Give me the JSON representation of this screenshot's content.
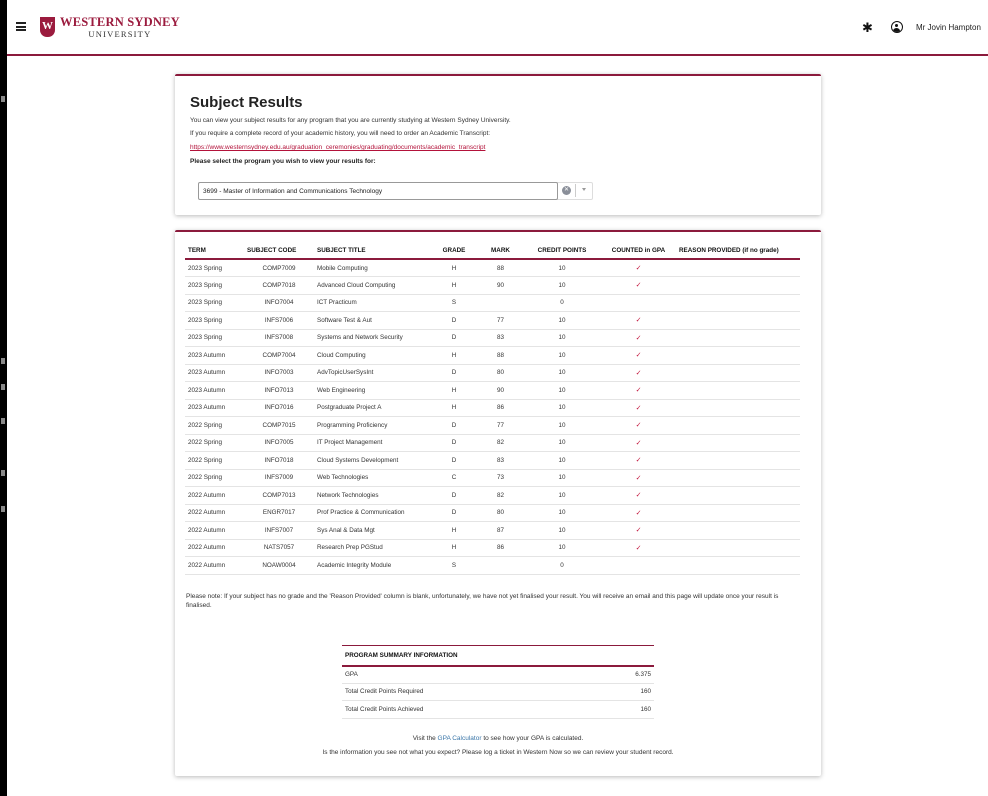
{
  "header": {
    "logo_mark": "W",
    "logo_line1": "WESTERN SYDNEY",
    "logo_line2": "UNIVERSITY",
    "user_name": "Mr Jovin Hampton"
  },
  "intro": {
    "title": "Subject Results",
    "para1": "You can view your subject results for any program that you are currently studying at Western Sydney University.",
    "para2": "If you require a complete record of your academic history, you will need to order an Academic Transcript:",
    "link": "https://www.westernsydney.edu.au/graduation_ceremonies/graduating/documents/academic_transcript",
    "select_prompt": "Please select the program you wish to view your results for:",
    "program_selected": "3699 - Master of Information and Communications Technology"
  },
  "results": {
    "columns": [
      "TERM",
      "SUBJECT CODE",
      "SUBJECT TITLE",
      "GRADE",
      "MARK",
      "CREDIT POINTS",
      "COUNTED in GPA",
      "REASON PROVIDED (if no grade)"
    ],
    "rows": [
      {
        "term": "2023 Spring",
        "code": "COMP7009",
        "title": "Mobile Computing",
        "grade": "H",
        "mark": "88",
        "credit": "10",
        "gpa": "✓",
        "reason": ""
      },
      {
        "term": "2023 Spring",
        "code": "COMP7018",
        "title": "Advanced Cloud Computing",
        "grade": "H",
        "mark": "90",
        "credit": "10",
        "gpa": "✓",
        "reason": ""
      },
      {
        "term": "2023 Spring",
        "code": "INFO7004",
        "title": "ICT Practicum",
        "grade": "S",
        "mark": "",
        "credit": "0",
        "gpa": "",
        "reason": ""
      },
      {
        "term": "2023 Spring",
        "code": "INFS7006",
        "title": "Software Test & Aut",
        "grade": "D",
        "mark": "77",
        "credit": "10",
        "gpa": "✓",
        "reason": ""
      },
      {
        "term": "2023 Spring",
        "code": "INFS7008",
        "title": "Systems and Network Security",
        "grade": "D",
        "mark": "83",
        "credit": "10",
        "gpa": "✓",
        "reason": ""
      },
      {
        "term": "2023 Autumn",
        "code": "COMP7004",
        "title": "Cloud Computing",
        "grade": "H",
        "mark": "88",
        "credit": "10",
        "gpa": "✓",
        "reason": ""
      },
      {
        "term": "2023 Autumn",
        "code": "INFO7003",
        "title": "AdvTopicUserSysInt",
        "grade": "D",
        "mark": "80",
        "credit": "10",
        "gpa": "✓",
        "reason": ""
      },
      {
        "term": "2023 Autumn",
        "code": "INFO7013",
        "title": "Web Engineering",
        "grade": "H",
        "mark": "90",
        "credit": "10",
        "gpa": "✓",
        "reason": ""
      },
      {
        "term": "2023 Autumn",
        "code": "INFO7016",
        "title": "Postgraduate Project A",
        "grade": "H",
        "mark": "86",
        "credit": "10",
        "gpa": "✓",
        "reason": ""
      },
      {
        "term": "2022 Spring",
        "code": "COMP7015",
        "title": "Programming Proficiency",
        "grade": "D",
        "mark": "77",
        "credit": "10",
        "gpa": "✓",
        "reason": ""
      },
      {
        "term": "2022 Spring",
        "code": "INFO7005",
        "title": "IT Project Management",
        "grade": "D",
        "mark": "82",
        "credit": "10",
        "gpa": "✓",
        "reason": ""
      },
      {
        "term": "2022 Spring",
        "code": "INFO7018",
        "title": "Cloud Systems Development",
        "grade": "D",
        "mark": "83",
        "credit": "10",
        "gpa": "✓",
        "reason": ""
      },
      {
        "term": "2022 Spring",
        "code": "INFS7009",
        "title": "Web Technologies",
        "grade": "C",
        "mark": "73",
        "credit": "10",
        "gpa": "✓",
        "reason": ""
      },
      {
        "term": "2022 Autumn",
        "code": "COMP7013",
        "title": "Network Technologies",
        "grade": "D",
        "mark": "82",
        "credit": "10",
        "gpa": "✓",
        "reason": ""
      },
      {
        "term": "2022 Autumn",
        "code": "ENGR7017",
        "title": "Prof Practice & Communication",
        "grade": "D",
        "mark": "80",
        "credit": "10",
        "gpa": "✓",
        "reason": ""
      },
      {
        "term": "2022 Autumn",
        "code": "INFS7007",
        "title": "Sys Anal & Data Mgt",
        "grade": "H",
        "mark": "87",
        "credit": "10",
        "gpa": "✓",
        "reason": ""
      },
      {
        "term": "2022 Autumn",
        "code": "NATS7057",
        "title": "Research Prep PGStud",
        "grade": "H",
        "mark": "86",
        "credit": "10",
        "gpa": "✓",
        "reason": ""
      },
      {
        "term": "2022 Autumn",
        "code": "NOAW0004",
        "title": "Academic Integrity Module",
        "grade": "S",
        "mark": "",
        "credit": "0",
        "gpa": "",
        "reason": ""
      }
    ],
    "note": "Please note: If your subject has no grade and the 'Reason Provided' column is blank, unfortunately, we have not yet finalised your result. You will receive an email and this page will update once your result is finalised."
  },
  "summary": {
    "heading": "PROGRAM SUMMARY INFORMATION",
    "rows": [
      {
        "label": "GPA",
        "value": "6.375"
      },
      {
        "label": "Total Credit Points Required",
        "value": "160"
      },
      {
        "label": "Total Credit Points Achieved",
        "value": "160"
      }
    ]
  },
  "footer": {
    "calc_prefix": "Visit the",
    "calc_link": "GPA Calculator",
    "calc_suffix": "to see how your GPA is calculated.",
    "help": "Is the information you see not what you expect? Please log a ticket in Western Now so we can review your student record."
  },
  "colors": {
    "brand": "#8b1a3c",
    "tick": "#c0113a",
    "link": "#3a76a8"
  }
}
